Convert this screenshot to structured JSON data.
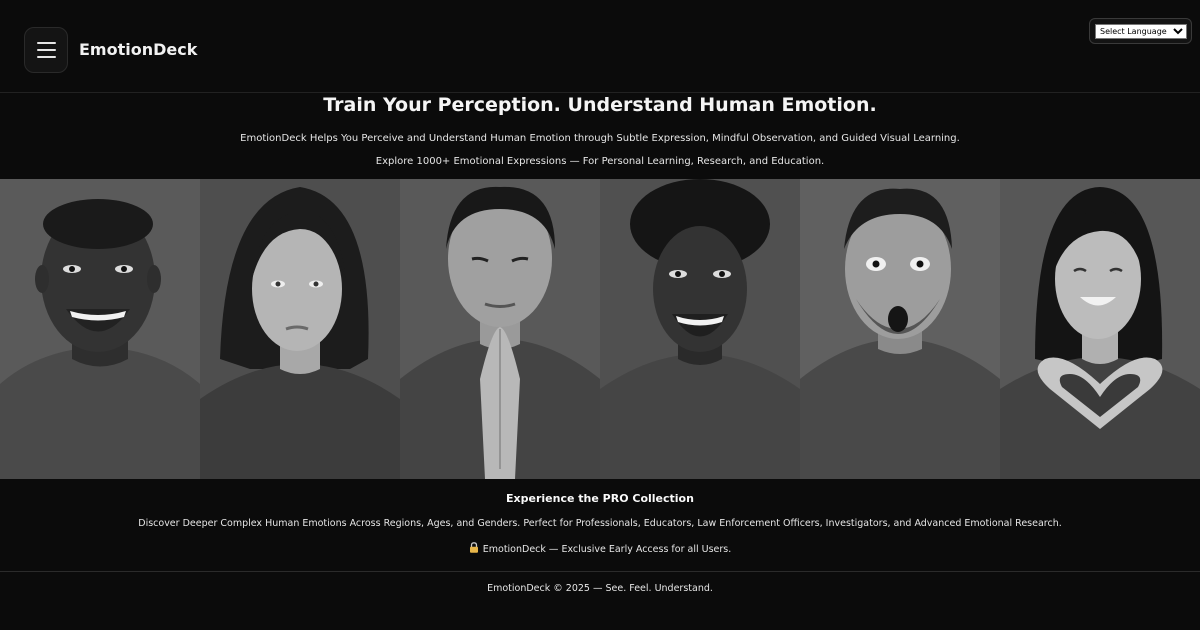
{
  "header": {
    "brand": "EmotionDeck",
    "menu_icon": "hamburger-menu-icon",
    "language_select": {
      "selected": "Select Language",
      "options": [
        "Select Language"
      ]
    }
  },
  "hero": {
    "title": "Train Your Perception. Understand Human Emotion.",
    "line1": "EmotionDeck Helps You Perceive and Understand Human Emotion through Subtle Expression, Mindful Observation, and Guided Visual Learning.",
    "line2": "Explore 1000+ Emotional Expressions — For Personal Learning, Research, and Education."
  },
  "portraits": [
    {
      "expression": "laughing",
      "gesture": "none"
    },
    {
      "expression": "neutral",
      "gesture": "none"
    },
    {
      "expression": "calm",
      "gesture": "praying-hands"
    },
    {
      "expression": "joyful",
      "gesture": "none"
    },
    {
      "expression": "surprised",
      "gesture": "none"
    },
    {
      "expression": "smiling",
      "gesture": "heart-hands"
    }
  ],
  "pro": {
    "title": "Experience the PRO Collection",
    "line1": "Discover Deeper Complex Human Emotions Across Regions, Ages, and Genders. Perfect for Professionals, Educators, Law Enforcement Officers, Investigators, and Advanced Emotional Research.",
    "lock_icon": "lock-icon",
    "line2": "EmotionDeck — Exclusive Early Access for all Users."
  },
  "footer": {
    "text": "EmotionDeck © 2025 — See. Feel. Understand."
  },
  "colors": {
    "background": "#0b0b0b",
    "text": "#ffffff",
    "lock": "#e8b64a"
  }
}
